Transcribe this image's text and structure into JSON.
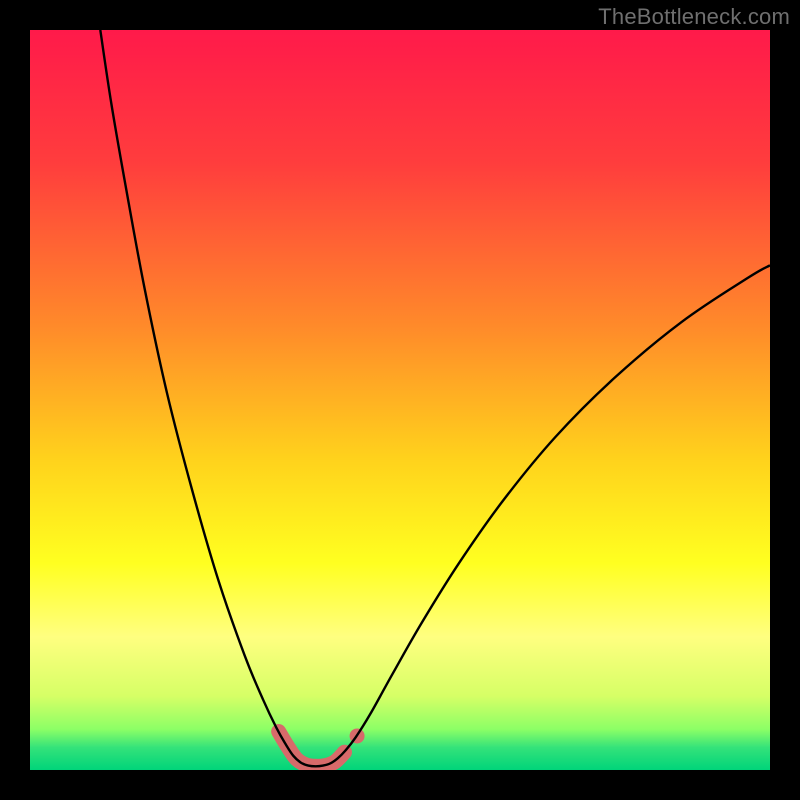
{
  "watermark": "TheBottleneck.com",
  "chart_data": {
    "type": "line",
    "title": "",
    "xlabel": "",
    "ylabel": "",
    "xlim": [
      0,
      100
    ],
    "ylim": [
      0,
      100
    ],
    "grid": false,
    "legend": false,
    "background_gradient": {
      "stops": [
        {
          "offset": 0.0,
          "color": "#ff1a4a"
        },
        {
          "offset": 0.18,
          "color": "#ff3d3d"
        },
        {
          "offset": 0.4,
          "color": "#ff8a2a"
        },
        {
          "offset": 0.58,
          "color": "#ffd21c"
        },
        {
          "offset": 0.72,
          "color": "#ffff20"
        },
        {
          "offset": 0.82,
          "color": "#ffff80"
        },
        {
          "offset": 0.9,
          "color": "#d6ff66"
        },
        {
          "offset": 0.945,
          "color": "#8cff66"
        },
        {
          "offset": 0.97,
          "color": "#33e27a"
        },
        {
          "offset": 1.0,
          "color": "#00d47a"
        }
      ]
    },
    "series": [
      {
        "name": "bottleneck-curve",
        "stroke": "#000000",
        "stroke_width": 2.4,
        "points": [
          {
            "x": 9.5,
            "y": 100.0
          },
          {
            "x": 11.0,
            "y": 90.0
          },
          {
            "x": 13.0,
            "y": 78.5
          },
          {
            "x": 15.5,
            "y": 65.0
          },
          {
            "x": 18.5,
            "y": 51.0
          },
          {
            "x": 22.0,
            "y": 37.5
          },
          {
            "x": 25.5,
            "y": 25.5
          },
          {
            "x": 29.0,
            "y": 15.5
          },
          {
            "x": 31.5,
            "y": 9.5
          },
          {
            "x": 33.3,
            "y": 5.7
          },
          {
            "x": 34.6,
            "y": 3.4
          },
          {
            "x": 35.6,
            "y": 1.9
          },
          {
            "x": 36.6,
            "y": 1.0
          },
          {
            "x": 37.6,
            "y": 0.6
          },
          {
            "x": 38.6,
            "y": 0.5
          },
          {
            "x": 39.6,
            "y": 0.6
          },
          {
            "x": 40.6,
            "y": 0.9
          },
          {
            "x": 41.6,
            "y": 1.6
          },
          {
            "x": 42.6,
            "y": 2.6
          },
          {
            "x": 44.0,
            "y": 4.4
          },
          {
            "x": 46.0,
            "y": 7.6
          },
          {
            "x": 49.0,
            "y": 13.0
          },
          {
            "x": 53.0,
            "y": 20.0
          },
          {
            "x": 58.0,
            "y": 28.0
          },
          {
            "x": 64.0,
            "y": 36.5
          },
          {
            "x": 71.0,
            "y": 45.0
          },
          {
            "x": 79.0,
            "y": 53.0
          },
          {
            "x": 88.0,
            "y": 60.5
          },
          {
            "x": 97.0,
            "y": 66.5
          },
          {
            "x": 100.0,
            "y": 68.2
          }
        ]
      },
      {
        "name": "highlight-segment",
        "stroke": "#d76a6a",
        "stroke_width": 15,
        "linecap": "round",
        "points": [
          {
            "x": 33.6,
            "y": 5.2
          },
          {
            "x": 34.8,
            "y": 3.2
          },
          {
            "x": 36.0,
            "y": 1.5
          },
          {
            "x": 37.3,
            "y": 0.7
          },
          {
            "x": 38.6,
            "y": 0.5
          },
          {
            "x": 39.9,
            "y": 0.6
          },
          {
            "x": 41.2,
            "y": 1.1
          },
          {
            "x": 42.5,
            "y": 2.4
          }
        ]
      },
      {
        "name": "highlight-dot",
        "type": "scatter",
        "fill": "#d76a6a",
        "radius": 7.5,
        "points": [
          {
            "x": 44.2,
            "y": 4.6
          }
        ]
      }
    ]
  }
}
